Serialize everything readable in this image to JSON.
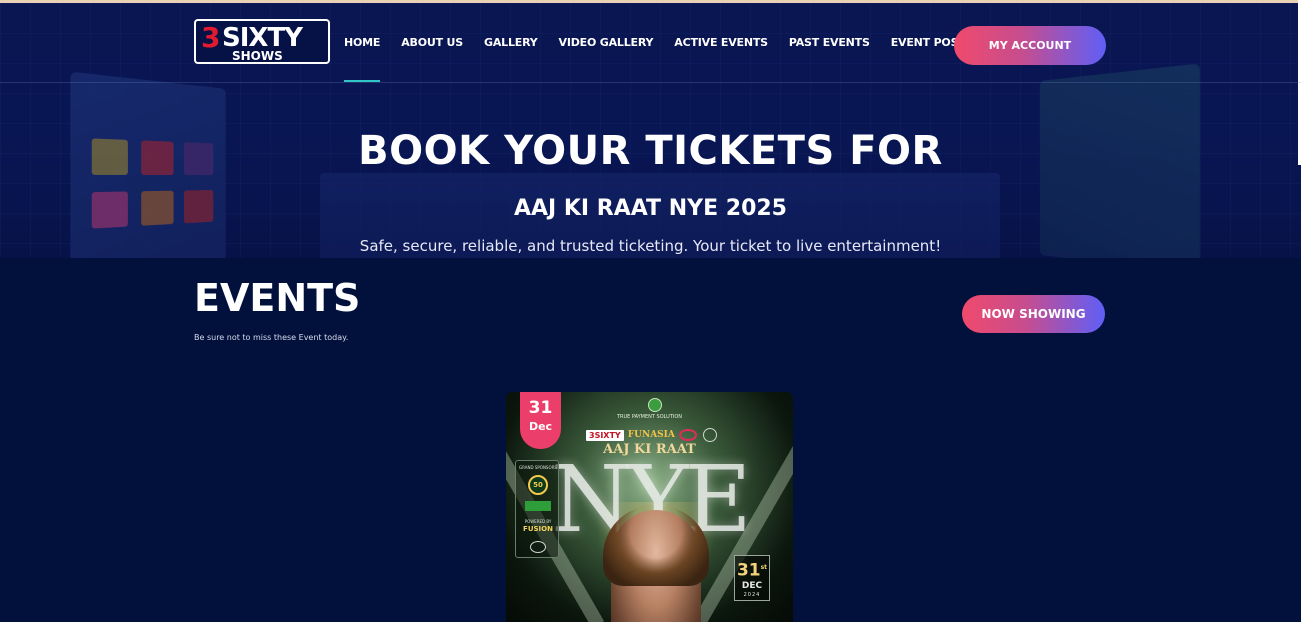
{
  "brand": {
    "logo_number": "3",
    "logo_word": "SIXTY",
    "logo_sub": "SHOWS"
  },
  "nav": {
    "items": [
      {
        "label": "HOME",
        "active": true
      },
      {
        "label": "ABOUT US",
        "active": false
      },
      {
        "label": "GALLERY",
        "active": false
      },
      {
        "label": "VIDEO GALLERY",
        "active": false
      },
      {
        "label": "ACTIVE EVENTS",
        "active": false
      },
      {
        "label": "PAST EVENTS",
        "active": false
      },
      {
        "label": "EVENT POSTERS",
        "active": false
      }
    ],
    "account_label": "MY ACCOUNT"
  },
  "hero": {
    "title": "BOOK YOUR TICKETS FOR",
    "event": "AAJ KI RAAT NYE 2025",
    "tagline": "Safe, secure, reliable, and trusted ticketing. Your ticket to live entertainment!"
  },
  "events": {
    "heading": "EVENTS",
    "subheading": "Be sure not to miss these Event today.",
    "filter_label": "NOW SHOWING"
  },
  "event_card": {
    "day": "31",
    "month": "Dec",
    "poster": {
      "sponsor_top": "TRUE PAYMENT SOLUTION",
      "logo_3sixty": "3SIXTY",
      "logo_funasia": "FUNASIA",
      "title": "AAJ KI RAAT",
      "big_text": "NYE",
      "sponsor_label": "GRAND SPONSORS",
      "sponsor_ring": "50",
      "powered_label": "POWERED BY",
      "fusion": "FUSION",
      "date_day": "31",
      "date_suffix": "st",
      "date_month": "DEC",
      "date_year": "2024"
    }
  },
  "colors": {
    "background": "#02103c",
    "accent_pink": "#f04a6c",
    "accent_blue": "#5e5ff7",
    "active_underline": "#2fc7c5",
    "date_badge": "#ec3e6a"
  }
}
